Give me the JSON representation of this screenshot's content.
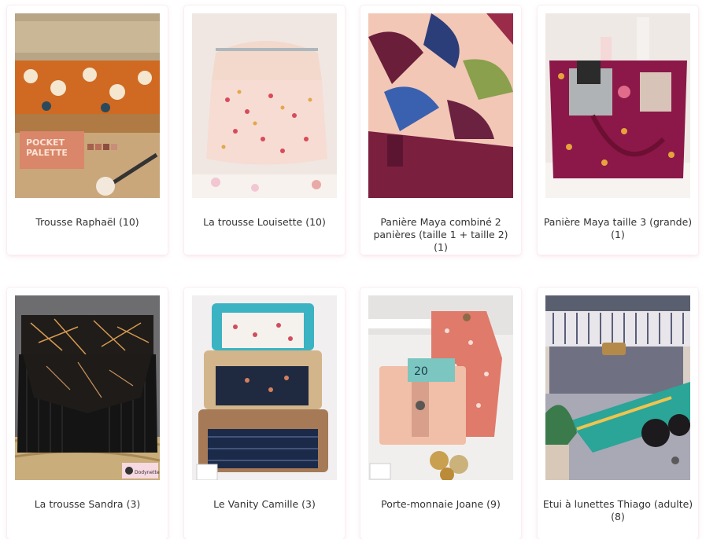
{
  "products": [
    {
      "title": "Trousse Raphaël (10)",
      "image_text": [
        "POCKET",
        "PALETTE"
      ]
    },
    {
      "title": "La trousse Louisette (10)"
    },
    {
      "title": "Panière Maya combiné 2 panières (taille 1 + taille 2) (1)"
    },
    {
      "title": "Panière Maya taille 3 (grande) (1)"
    },
    {
      "title": "La trousse Sandra (3)",
      "watermark": "Dodynette"
    },
    {
      "title": "Le Vanity Camille (3)"
    },
    {
      "title": "Porte-monnaie Joane (9)",
      "image_text": [
        "20"
      ]
    },
    {
      "title": "Etui à lunettes Thiago (adulte) (8)"
    }
  ],
  "colors": {
    "card_shadow": "#f3c9d3",
    "text": "#333333",
    "background": "#ffffff"
  }
}
